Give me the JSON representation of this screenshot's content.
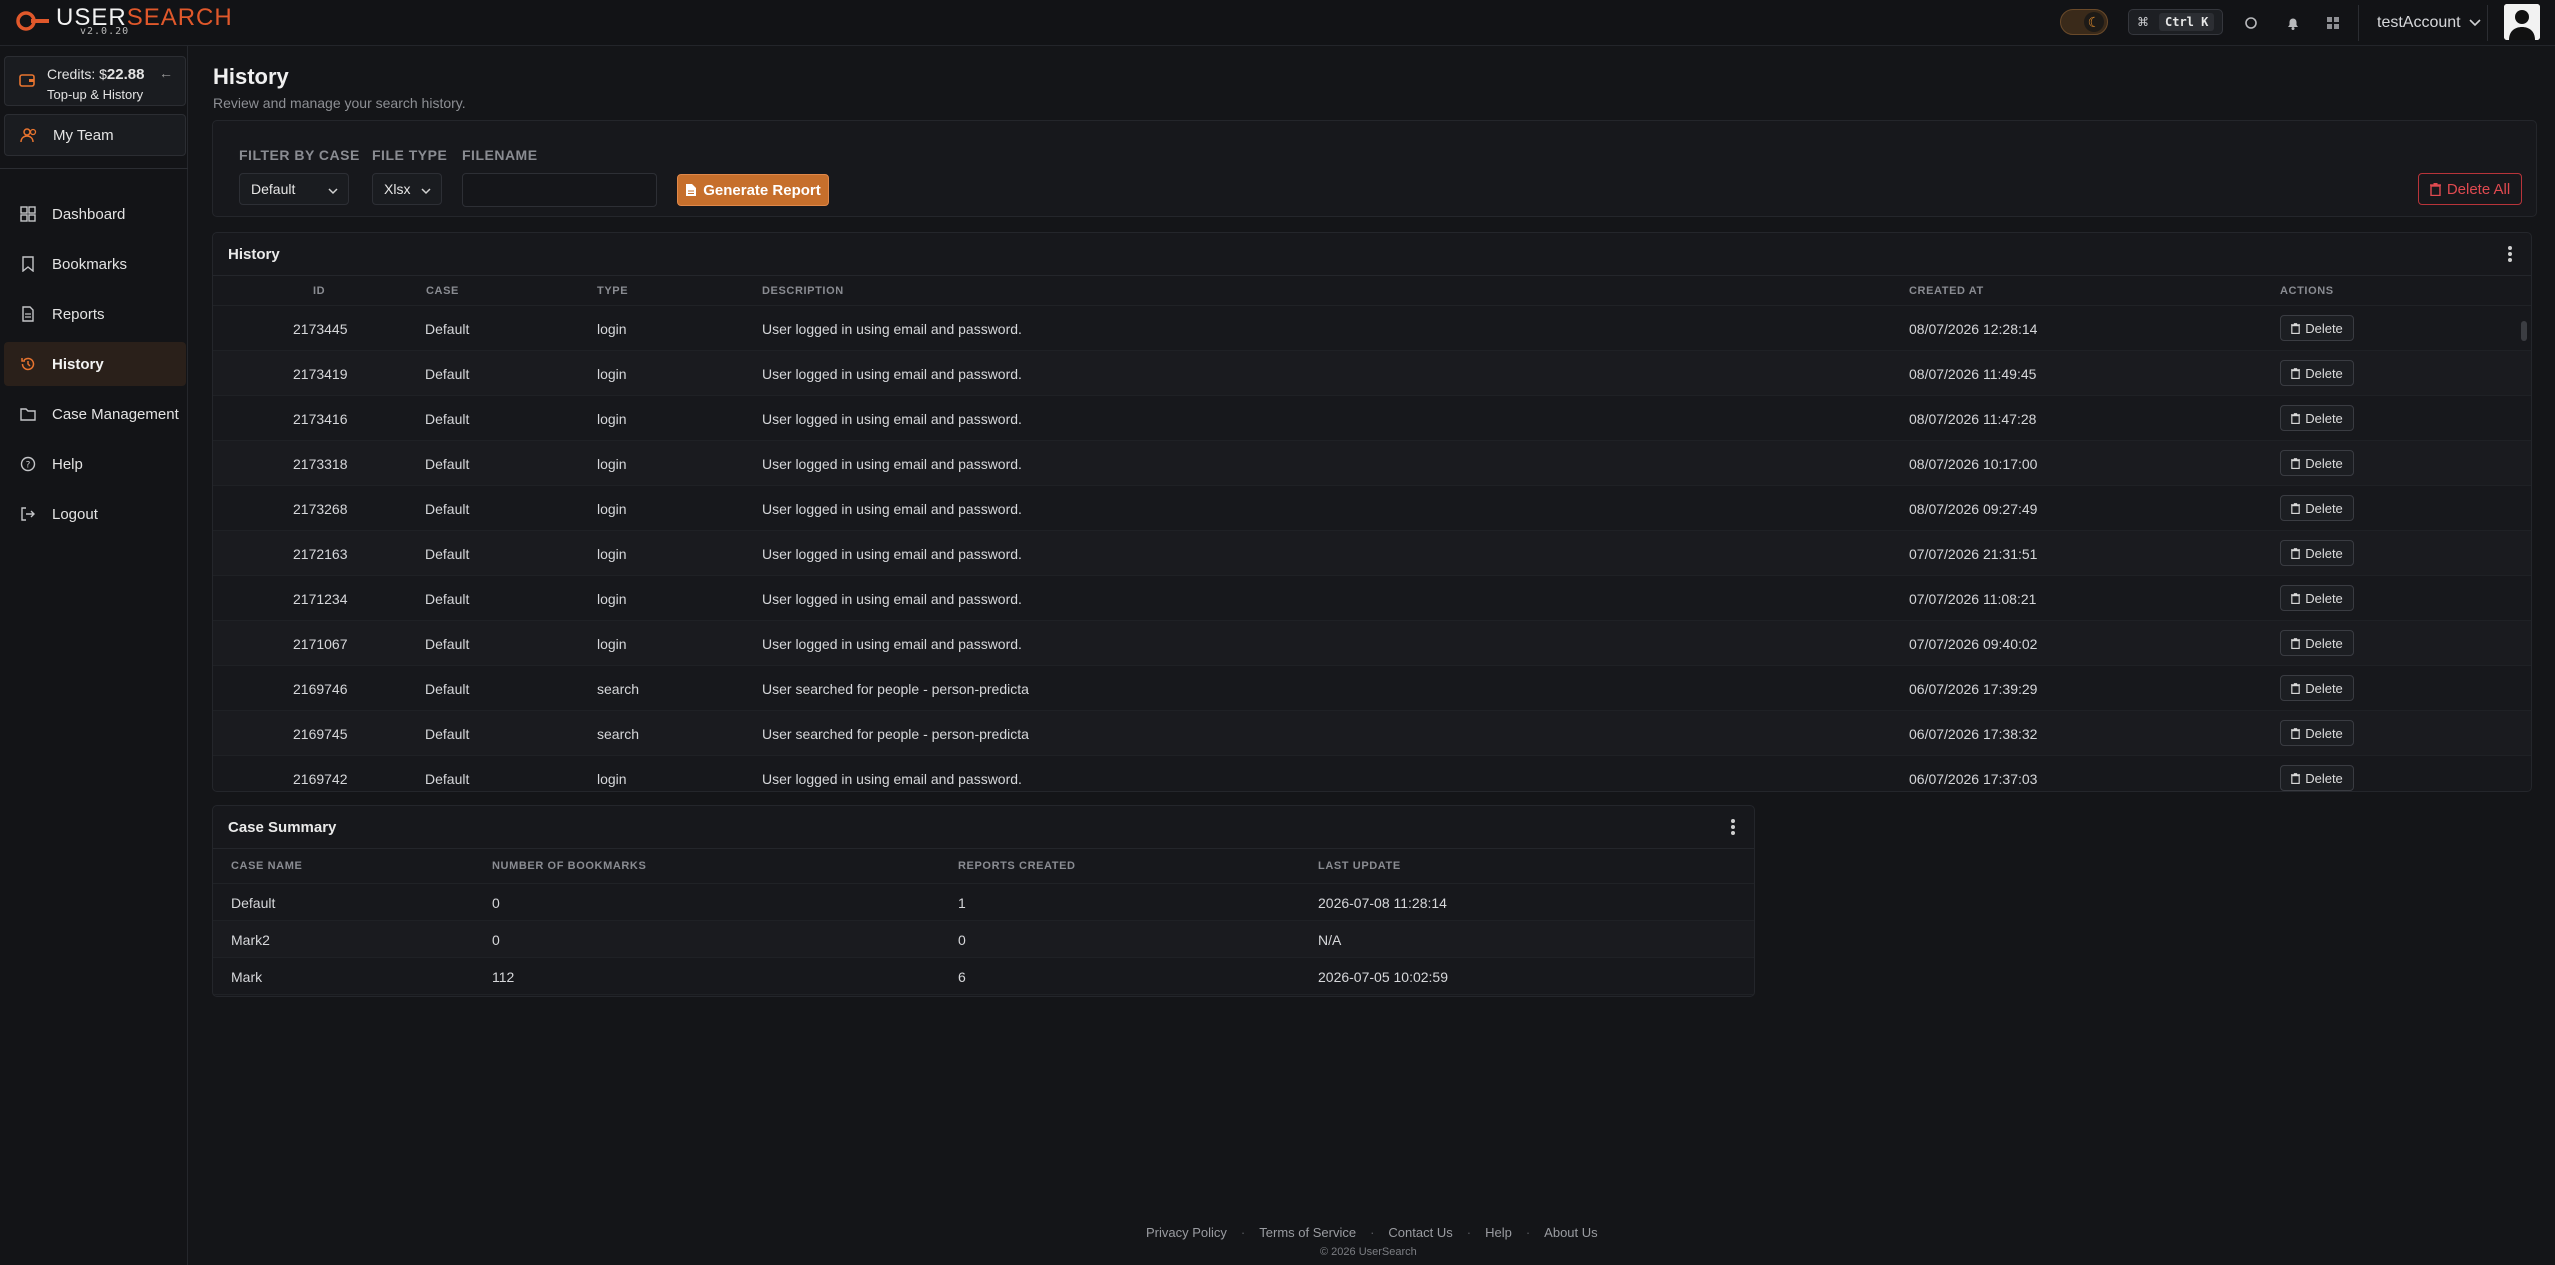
{
  "app": {
    "name_main": "USER",
    "name_accent": "SEARCH",
    "version": "v2.0.20"
  },
  "topbar": {
    "shortcut_key": "Ctrl K",
    "account_name": "testAccount"
  },
  "sidebar": {
    "credits_label": "Credits: $",
    "credits_value": "22.88",
    "credits_sub": "Top-up & History",
    "team": "My Team",
    "items": [
      {
        "label": "Dashboard",
        "icon": "dashboard-icon"
      },
      {
        "label": "Bookmarks",
        "icon": "bookmark-icon"
      },
      {
        "label": "Reports",
        "icon": "report-icon"
      },
      {
        "label": "History",
        "icon": "history-icon"
      },
      {
        "label": "Case Management",
        "icon": "folder-icon"
      },
      {
        "label": "Help",
        "icon": "help-icon"
      },
      {
        "label": "Logout",
        "icon": "logout-icon"
      }
    ],
    "active": "History"
  },
  "page": {
    "title": "History",
    "subtitle": "Review and manage your search history."
  },
  "filters": {
    "case_label": "FILTER BY CASE",
    "case_value": "Default",
    "type_label": "FILE TYPE",
    "type_value": "Xlsx",
    "filename_label": "FILENAME",
    "filename_value": "",
    "generate_label": "Generate Report",
    "delete_all_label": "Delete All"
  },
  "history": {
    "title": "History",
    "columns": [
      "ID",
      "CASE",
      "TYPE",
      "DESCRIPTION",
      "CREATED AT",
      "ACTIONS"
    ],
    "delete_label": "Delete",
    "rows": [
      {
        "id": "2173445",
        "case": "Default",
        "type": "login",
        "description": "User logged in using email and password.",
        "created": "08/07/2026 12:28:14"
      },
      {
        "id": "2173419",
        "case": "Default",
        "type": "login",
        "description": "User logged in using email and password.",
        "created": "08/07/2026 11:49:45"
      },
      {
        "id": "2173416",
        "case": "Default",
        "type": "login",
        "description": "User logged in using email and password.",
        "created": "08/07/2026 11:47:28"
      },
      {
        "id": "2173318",
        "case": "Default",
        "type": "login",
        "description": "User logged in using email and password.",
        "created": "08/07/2026 10:17:00"
      },
      {
        "id": "2173268",
        "case": "Default",
        "type": "login",
        "description": "User logged in using email and password.",
        "created": "08/07/2026 09:27:49"
      },
      {
        "id": "2172163",
        "case": "Default",
        "type": "login",
        "description": "User logged in using email and password.",
        "created": "07/07/2026 21:31:51"
      },
      {
        "id": "2171234",
        "case": "Default",
        "type": "login",
        "description": "User logged in using email and password.",
        "created": "07/07/2026 11:08:21"
      },
      {
        "id": "2171067",
        "case": "Default",
        "type": "login",
        "description": "User logged in using email and password.",
        "created": "07/07/2026 09:40:02"
      },
      {
        "id": "2169746",
        "case": "Default",
        "type": "search",
        "description": "User searched for people - person-predicta",
        "created": "06/07/2026 17:39:29"
      },
      {
        "id": "2169745",
        "case": "Default",
        "type": "search",
        "description": "User searched for people - person-predicta",
        "created": "06/07/2026 17:38:32"
      },
      {
        "id": "2169742",
        "case": "Default",
        "type": "login",
        "description": "User logged in using email and password.",
        "created": "06/07/2026 17:37:03"
      }
    ]
  },
  "summary": {
    "title": "Case Summary",
    "columns": [
      "CASE NAME",
      "NUMBER OF BOOKMARKS",
      "REPORTS CREATED",
      "LAST UPDATE"
    ],
    "rows": [
      {
        "name": "Default",
        "bookmarks": "0",
        "reports": "1",
        "updated": "2026-07-08 11:28:14"
      },
      {
        "name": "Mark2",
        "bookmarks": "0",
        "reports": "0",
        "updated": "N/A"
      },
      {
        "name": "Mark",
        "bookmarks": "112",
        "reports": "6",
        "updated": "2026-07-05 10:02:59"
      }
    ]
  },
  "footer": {
    "links": [
      "Privacy Policy",
      "Terms of Service",
      "Contact Us",
      "Help",
      "About Us"
    ],
    "copyright": "© 2026 UserSearch"
  },
  "colors": {
    "accent": "#e8742f",
    "danger": "#e04a50",
    "background": "#141518"
  }
}
